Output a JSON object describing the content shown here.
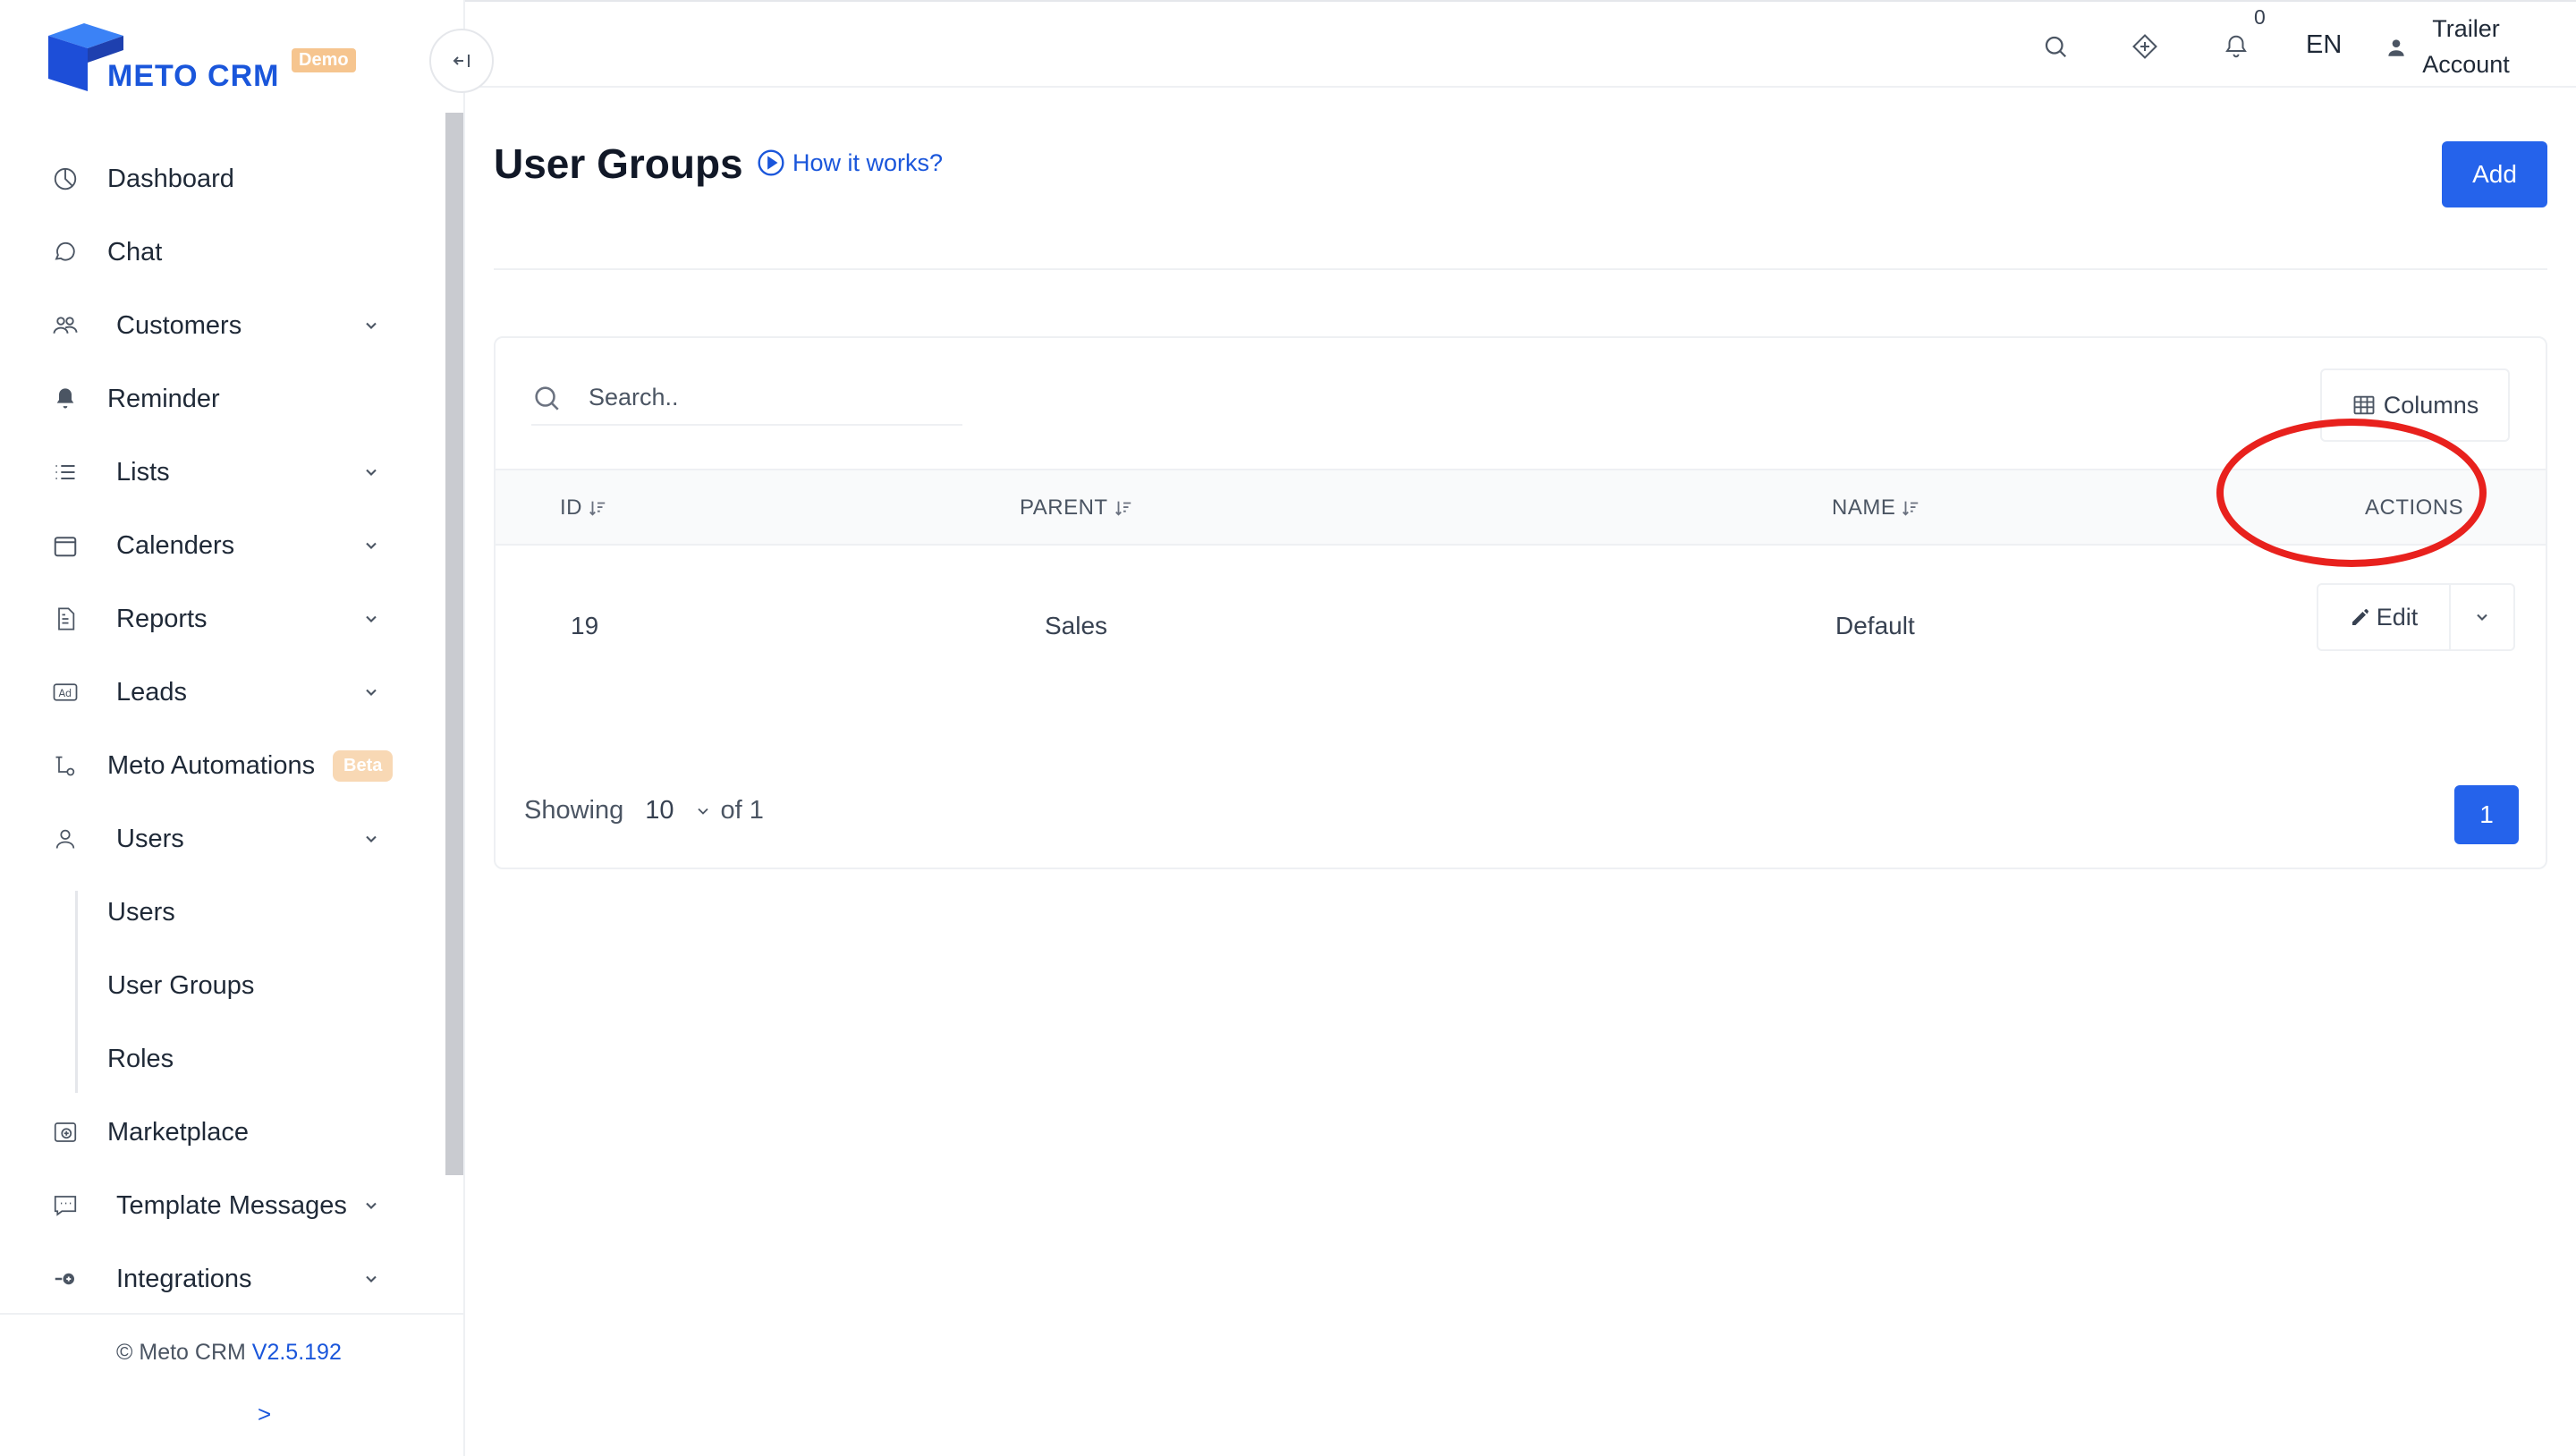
{
  "brand": {
    "name": "METO CRM",
    "badge": "Demo",
    "color": "#1a56db"
  },
  "sidebar": {
    "items": [
      {
        "label": "Dashboard",
        "icon": "dashboard-icon"
      },
      {
        "label": "Chat",
        "icon": "chat-icon"
      },
      {
        "label": "Customers",
        "icon": "customers-icon",
        "has_children": true
      },
      {
        "label": "Reminder",
        "icon": "bell-icon"
      },
      {
        "label": "Lists",
        "icon": "list-icon",
        "has_children": true
      },
      {
        "label": "Calenders",
        "icon": "calendar-icon",
        "has_children": true
      },
      {
        "label": "Reports",
        "icon": "report-icon",
        "has_children": true
      },
      {
        "label": "Leads",
        "icon": "ad-icon",
        "has_children": true
      },
      {
        "label": "Meto Automations",
        "icon": "automation-icon",
        "badge": "Beta"
      },
      {
        "label": "Users",
        "icon": "user-icon",
        "has_children": true,
        "expanded": true
      },
      {
        "label": "Users",
        "sub": true
      },
      {
        "label": "User Groups",
        "sub": true,
        "active": true
      },
      {
        "label": "Roles",
        "sub": true
      },
      {
        "label": "Marketplace",
        "icon": "marketplace-icon"
      },
      {
        "label": "Template Messages",
        "icon": "message-icon",
        "has_children": true
      },
      {
        "label": "Integrations",
        "icon": "integration-icon",
        "has_children": true
      }
    ],
    "footer": {
      "copyright": "© Meto CRM",
      "version": "V2.5.192",
      "expand": ">"
    }
  },
  "topbar": {
    "notifications": "0",
    "language": "EN",
    "account_line1": "Trailer",
    "account_line2": "Account"
  },
  "page": {
    "title": "User Groups",
    "help_link": "How it works?",
    "add_label": "Add"
  },
  "table": {
    "search_placeholder": "Search..",
    "columns_label": "Columns",
    "headers": {
      "id": "ID",
      "parent": "PARENT",
      "name": "NAME",
      "actions": "ACTIONS"
    },
    "rows": [
      {
        "id": "19",
        "parent": "Sales",
        "name": "Default",
        "action": "Edit"
      }
    ],
    "footer": {
      "showing": "Showing",
      "page_size": "10",
      "of_total": "of 1",
      "current_page": "1"
    }
  },
  "colors": {
    "primary": "#2563eb",
    "highlight": "#e8211d",
    "beta": "#f8d8b4"
  }
}
